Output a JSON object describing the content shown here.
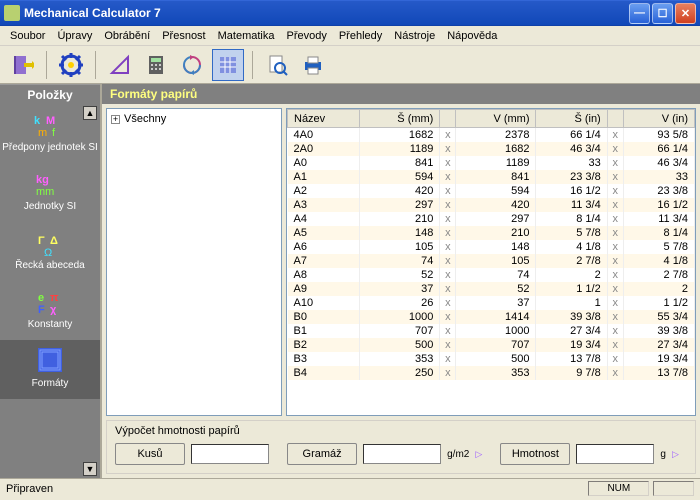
{
  "window": {
    "title": "Mechanical Calculator 7"
  },
  "menu": [
    "Soubor",
    "Úpravy",
    "Obrábění",
    "Přesnost",
    "Matematika",
    "Převody",
    "Přehledy",
    "Nástroje",
    "Nápověda"
  ],
  "sidebar": {
    "header": "Položky",
    "items": [
      {
        "label": "Předpony jednotek SI"
      },
      {
        "label": "Jednotky SI"
      },
      {
        "label": "Řecká abeceda"
      },
      {
        "label": "Konstanty"
      },
      {
        "label": "Formáty"
      }
    ]
  },
  "main": {
    "header": "Formáty papírů",
    "tree_root": "Všechny",
    "columns": [
      "Název",
      "Š (mm)",
      "",
      "V (mm)",
      "Š (in)",
      "",
      "V (in)"
    ],
    "rows": [
      [
        "4A0",
        "1682",
        "x",
        "2378",
        "66 1/4",
        "x",
        "93 5/8"
      ],
      [
        "2A0",
        "1189",
        "x",
        "1682",
        "46 3/4",
        "x",
        "66 1/4"
      ],
      [
        "A0",
        "841",
        "x",
        "1189",
        "33",
        "x",
        "46 3/4"
      ],
      [
        "A1",
        "594",
        "x",
        "841",
        "23 3/8",
        "x",
        "33"
      ],
      [
        "A2",
        "420",
        "x",
        "594",
        "16 1/2",
        "x",
        "23 3/8"
      ],
      [
        "A3",
        "297",
        "x",
        "420",
        "11 3/4",
        "x",
        "16 1/2"
      ],
      [
        "A4",
        "210",
        "x",
        "297",
        "8 1/4",
        "x",
        "11 3/4"
      ],
      [
        "A5",
        "148",
        "x",
        "210",
        "5 7/8",
        "x",
        "8 1/4"
      ],
      [
        "A6",
        "105",
        "x",
        "148",
        "4 1/8",
        "x",
        "5 7/8"
      ],
      [
        "A7",
        "74",
        "x",
        "105",
        "2 7/8",
        "x",
        "4 1/8"
      ],
      [
        "A8",
        "52",
        "x",
        "74",
        "2",
        "x",
        "2 7/8"
      ],
      [
        "A9",
        "37",
        "x",
        "52",
        "1 1/2",
        "x",
        "2"
      ],
      [
        "A10",
        "26",
        "x",
        "37",
        "1",
        "x",
        "1 1/2"
      ],
      [
        "B0",
        "1000",
        "x",
        "1414",
        "39 3/8",
        "x",
        "55 3/4"
      ],
      [
        "B1",
        "707",
        "x",
        "1000",
        "27 3/4",
        "x",
        "39 3/8"
      ],
      [
        "B2",
        "500",
        "x",
        "707",
        "19 3/4",
        "x",
        "27 3/4"
      ],
      [
        "B3",
        "353",
        "x",
        "500",
        "13 7/8",
        "x",
        "19 3/4"
      ],
      [
        "B4",
        "250",
        "x",
        "353",
        "9 7/8",
        "x",
        "13 7/8"
      ]
    ]
  },
  "bottom": {
    "title": "Výpočet hmotnosti papírů",
    "pieces_btn": "Kusů",
    "grammage_btn": "Gramáž",
    "grammage_unit": "g/m2",
    "weight_btn": "Hmotnost",
    "weight_unit": "g"
  },
  "status": {
    "left": "Připraven",
    "num": "NUM"
  }
}
